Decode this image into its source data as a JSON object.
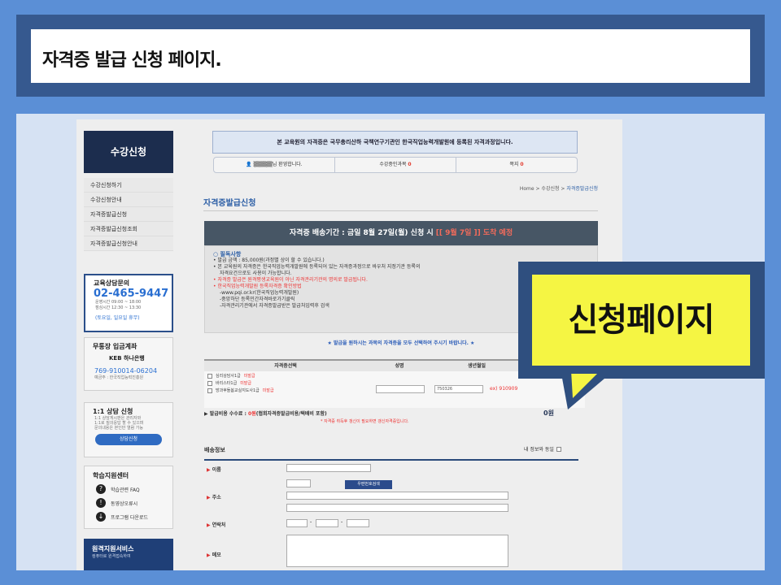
{
  "slide": {
    "title": "자격증 발급 신청 페이지."
  },
  "sidebar": {
    "header": "수강신청",
    "items": [
      "수강신청하기",
      "수강신청안내",
      "자격증발급신청",
      "자격증발급신청조회",
      "자격증발급신청안내"
    ]
  },
  "consult": {
    "title": "교육상담문의",
    "phone": "02-465-9447",
    "hours1": "운영시간 09:00 ~ 18:00",
    "hours2": "점심시간 12:30 ~ 13:30",
    "note": "(토요일, 일요일 휴무)"
  },
  "bank": {
    "title": "무통장 입금계좌",
    "bank_name": "KEB 하나은행",
    "account": "769-910014-06204",
    "holder": "예금주 : 한국직업능력진흥원"
  },
  "one_to_one": {
    "title": "1:1 상담 신청",
    "desc1": "1:1 상담게시판은 관리자와",
    "desc2": "1:1로 질의응답 할 수 있으며",
    "desc3": "문의내용은 본인만 열람 가능",
    "button": "상담신청"
  },
  "support": {
    "title": "학습지원센터",
    "faq": "학습관련 FAQ",
    "video": "동영상오류시",
    "download": "프로그램 다운로드"
  },
  "remote": {
    "title": "원격지원서비스",
    "desc": "컴퓨터로 원격접속하여"
  },
  "notice": "본 교육원의 자격증은 국무총리산하 국책연구기관인 한국직업능력개발원에 등록된 자격과정입니다.",
  "tabs": {
    "welcome": "님 환영합니다.",
    "courses_label": "수강중인과목",
    "courses_count": "0",
    "notes_label": "쪽지",
    "notes_count": "0"
  },
  "breadcrumb": {
    "home": "Home > 수강신청 > ",
    "current": "자격증발급신청"
  },
  "page_title": "자격증발급신청",
  "banner": {
    "text": "자격증 배송기간 : 금일 8월 27일(월) 신청 시 ",
    "highlight": "[[ 9월 7일 ]] 도착 예정"
  },
  "notes": {
    "head": "필독사항",
    "line1": "발급 금액 : 85,000원(과정별 상이 할 수 있습니다.)",
    "line2": "본 교육원의 자격증은 한국직업능력개발원에 등록되어 있는 자격증과정으로 바우처 지정기관 등록의",
    "line3": "자격요건으로도 사용이 가능합니다.",
    "line4": "자격증 발급은 원격평생교육원이 아닌 자격관리기관의 명의로 발급됩니다.",
    "line5": "한국직업능력개발원 등록자격증 확인방법",
    "line6": "-www.pqi.or.kr(한국직업능력개발원)",
    "line7": "-중앙하단 등록민간자격바로가기클릭",
    "line8": "-자격관리기관에서 자격증발급받은 발급처입력후 검색"
  },
  "select_msg": "★ 발급을 원하시는 과목의 자격증을 모두 선택하여 주시기 바랍니다. ★",
  "table": {
    "headers": [
      "자격증선택",
      "성명",
      "생년월일"
    ],
    "rows": [
      {
        "name": "심리상담사1급",
        "status": "미발급"
      },
      {
        "name": "바리스타1급",
        "status": "미발급"
      },
      {
        "name": "방과후돌봄교실지도사1급",
        "status": "미발급"
      }
    ],
    "birth_value": "750326",
    "birth_example": "ex) 910909"
  },
  "fee": {
    "label": "▶ 발급비용 수수료 : ",
    "amount": "0원",
    "desc": "(협회자격증발급비용/택배비 포함)",
    "note": "* 자격증 취득후 갱신이 필요하면 갱신자격증입니다.",
    "total": "0원"
  },
  "shipping": {
    "title": "배송정보",
    "same_label": "내 정보와 동일",
    "name_label": "이름",
    "address_label": "주소",
    "zip_button": "우편번호검색",
    "contact_label": "연락처",
    "memo_label": "메모"
  },
  "callout": "신청페이지"
}
